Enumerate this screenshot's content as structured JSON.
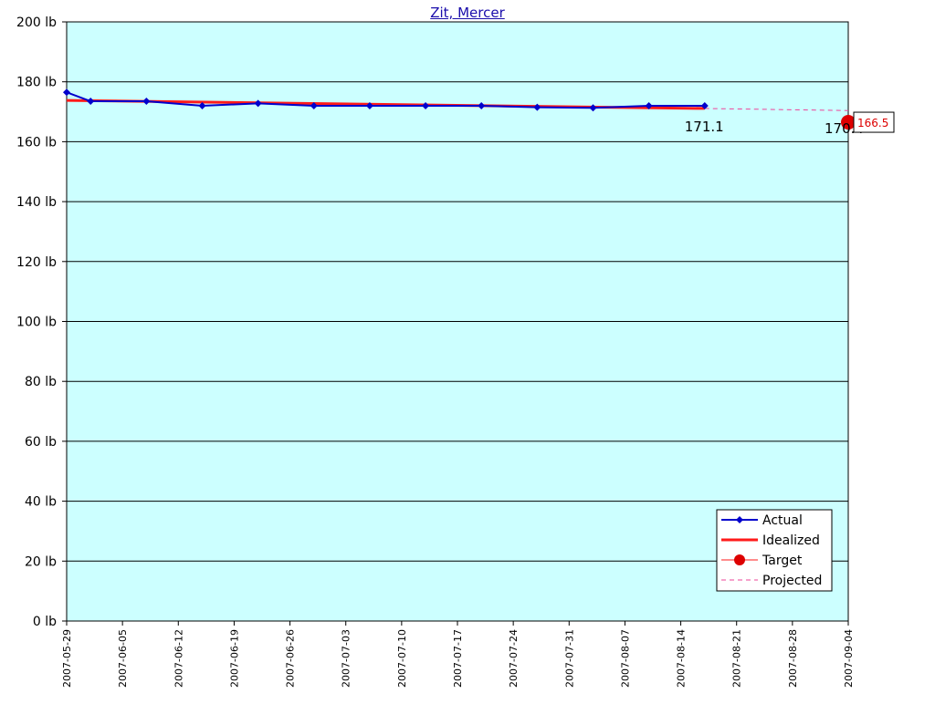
{
  "colors": {
    "plot_bg": "#ccffff",
    "actual": "#0000cc",
    "idealized": "#ff1a1a",
    "target": "#dd0000",
    "projected": "#ee4499",
    "grid": "#000000"
  },
  "chart_data": {
    "type": "line",
    "title": "Zit, Mercer",
    "ylim": [
      0,
      200
    ],
    "yticks": [
      0,
      20,
      40,
      60,
      80,
      100,
      120,
      140,
      160,
      180,
      200
    ],
    "ytick_labels": [
      "0 lb",
      "20 lb",
      "40 lb",
      "60 lb",
      "80 lb",
      "100 lb",
      "120 lb",
      "140 lb",
      "160 lb",
      "180 lb",
      "200 lb"
    ],
    "xlim": [
      "2007-05-29",
      "2007-09-04"
    ],
    "xtick_labels": [
      "2007-05-29",
      "2007-06-05",
      "2007-06-12",
      "2007-06-19",
      "2007-06-26",
      "2007-07-03",
      "2007-07-10",
      "2007-07-17",
      "2007-07-24",
      "2007-07-31",
      "2007-08-07",
      "2007-08-14",
      "2007-08-21",
      "2007-08-28",
      "2007-09-04"
    ],
    "grid": true,
    "legend_position": "bottom-right",
    "series": [
      {
        "name": "Actual",
        "x": [
          "2007-05-29",
          "2007-06-01",
          "2007-06-08",
          "2007-06-15",
          "2007-06-22",
          "2007-06-29",
          "2007-07-06",
          "2007-07-13",
          "2007-07-20",
          "2007-07-27",
          "2007-08-03",
          "2007-08-10",
          "2007-08-17"
        ],
        "y": [
          176.5,
          173.5,
          173.5,
          172.0,
          172.8,
          172.0,
          172.0,
          172.0,
          172.0,
          171.5,
          171.3,
          172.0,
          172.0
        ]
      },
      {
        "name": "Idealized",
        "x": [
          "2007-05-29",
          "2007-08-17"
        ],
        "y": [
          173.8,
          171.1
        ]
      },
      {
        "name": "Target",
        "x": [
          "2007-09-04"
        ],
        "y": [
          166.5
        ]
      },
      {
        "name": "Projected",
        "x": [
          "2007-08-17",
          "2007-09-04"
        ],
        "y": [
          171.1,
          170.4
        ]
      }
    ],
    "annotations": [
      {
        "text": "171.1",
        "x": "2007-08-17",
        "y": 171.1
      },
      {
        "text": "170.4",
        "x": "2007-09-04",
        "y": 170.4
      },
      {
        "text": "166.5",
        "x": "2007-09-04",
        "y": 166.5
      }
    ]
  }
}
